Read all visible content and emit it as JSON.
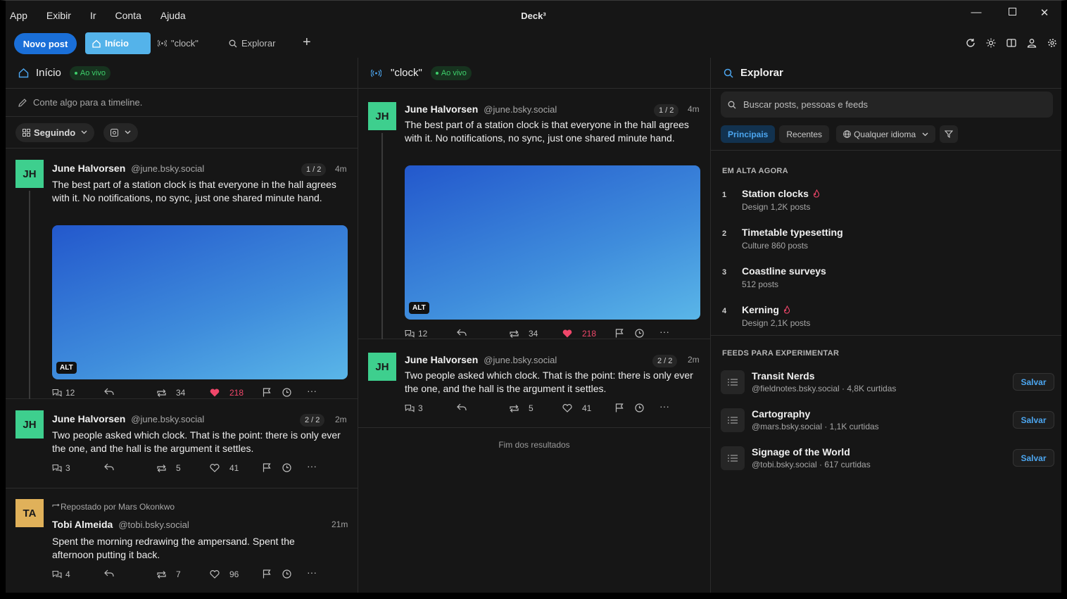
{
  "menu": [
    "App",
    "Exibir",
    "Ir",
    "Conta",
    "Ajuda"
  ],
  "app_title": "Deck³",
  "tabbar": {
    "new_post": "Novo post",
    "tabs": [
      {
        "label": "Início"
      },
      {
        "label": "\"clock\""
      },
      {
        "label": "Explorar"
      }
    ]
  },
  "col_home": {
    "title": "Início",
    "live": "Ao vivo",
    "composer": "Conte algo para a timeline.",
    "filter_following": "Seguindo",
    "posts": [
      {
        "initials": "JH",
        "name": "June Halvorsen",
        "handle": "@june.bsky.social",
        "count": "1 / 2",
        "time": "4m",
        "text": "The best part of a station clock is that everyone in the hall agrees with it. No notifications, no sync, just one shared minute hand.",
        "alt": "ALT",
        "replies": "12",
        "reposts": "34",
        "likes": "218"
      },
      {
        "initials": "JH",
        "name": "June Halvorsen",
        "handle": "@june.bsky.social",
        "count": "2 / 2",
        "time": "2m",
        "text": "Two people asked which clock. That is the point: there is only ever the one, and the hall is the argument it settles.",
        "replies": "3",
        "reposts": "5",
        "likes": "41"
      },
      {
        "repost_by": "Repostado por Mars Okonkwo",
        "initials": "TA",
        "name": "Tobi Almeida",
        "handle": "@tobi.bsky.social",
        "time": "21m",
        "text": "Spent the morning redrawing the ampersand. Spent the afternoon putting it back.",
        "replies": "4",
        "reposts": "7",
        "likes": "96"
      }
    ]
  },
  "col_clock": {
    "title": "\"clock\"",
    "live": "Ao vivo",
    "posts": [
      {
        "initials": "JH",
        "name": "June Halvorsen",
        "handle": "@june.bsky.social",
        "count": "1 / 2",
        "time": "4m",
        "text": "The best part of a station clock is that everyone in the hall agrees with it. No notifications, no sync, just one shared minute hand.",
        "alt": "ALT",
        "replies": "12",
        "reposts": "34",
        "likes": "218"
      },
      {
        "initials": "JH",
        "name": "June Halvorsen",
        "handle": "@june.bsky.social",
        "count": "2 / 2",
        "time": "2m",
        "text": "Two people asked which clock. That is the point: there is only ever the one, and the hall is the argument it settles.",
        "replies": "3",
        "reposts": "5",
        "likes": "41"
      }
    ],
    "end": "Fim dos resultados"
  },
  "col_explore": {
    "title": "Explorar",
    "search_placeholder": "Buscar posts, pessoas e feeds",
    "tabs": [
      "Principais",
      "Recentes"
    ],
    "language": "Qualquer idioma",
    "trending_title": "EM ALTA AGORA",
    "trending": [
      {
        "rank": "1",
        "title": "Station clocks",
        "hot": true,
        "meta": "Design   1,2K posts"
      },
      {
        "rank": "2",
        "title": "Timetable typesetting",
        "hot": false,
        "meta": "Culture   860 posts"
      },
      {
        "rank": "3",
        "title": "Coastline surveys",
        "hot": false,
        "meta": "512 posts"
      },
      {
        "rank": "4",
        "title": "Kerning",
        "hot": true,
        "meta": "Design   2,1K posts"
      }
    ],
    "feeds_title": "FEEDS PARA EXPERIMENTAR",
    "feeds": [
      {
        "name": "Transit Nerds",
        "meta": "@fieldnotes.bsky.social · 4,8K curtidas",
        "save": "Salvar"
      },
      {
        "name": "Cartography",
        "meta": "@mars.bsky.social · 1,1K curtidas",
        "save": "Salvar"
      },
      {
        "name": "Signage of the World",
        "meta": "@tobi.bsky.social · 617 curtidas",
        "save": "Salvar"
      }
    ]
  },
  "colors": {
    "accent": "#1a6fd8",
    "active_tab": "#54b3ea",
    "like": "#f0476a",
    "live": "#3ecf6b",
    "avatar_jh": "#3ecf8e",
    "avatar_ta": "#e0b15a"
  }
}
